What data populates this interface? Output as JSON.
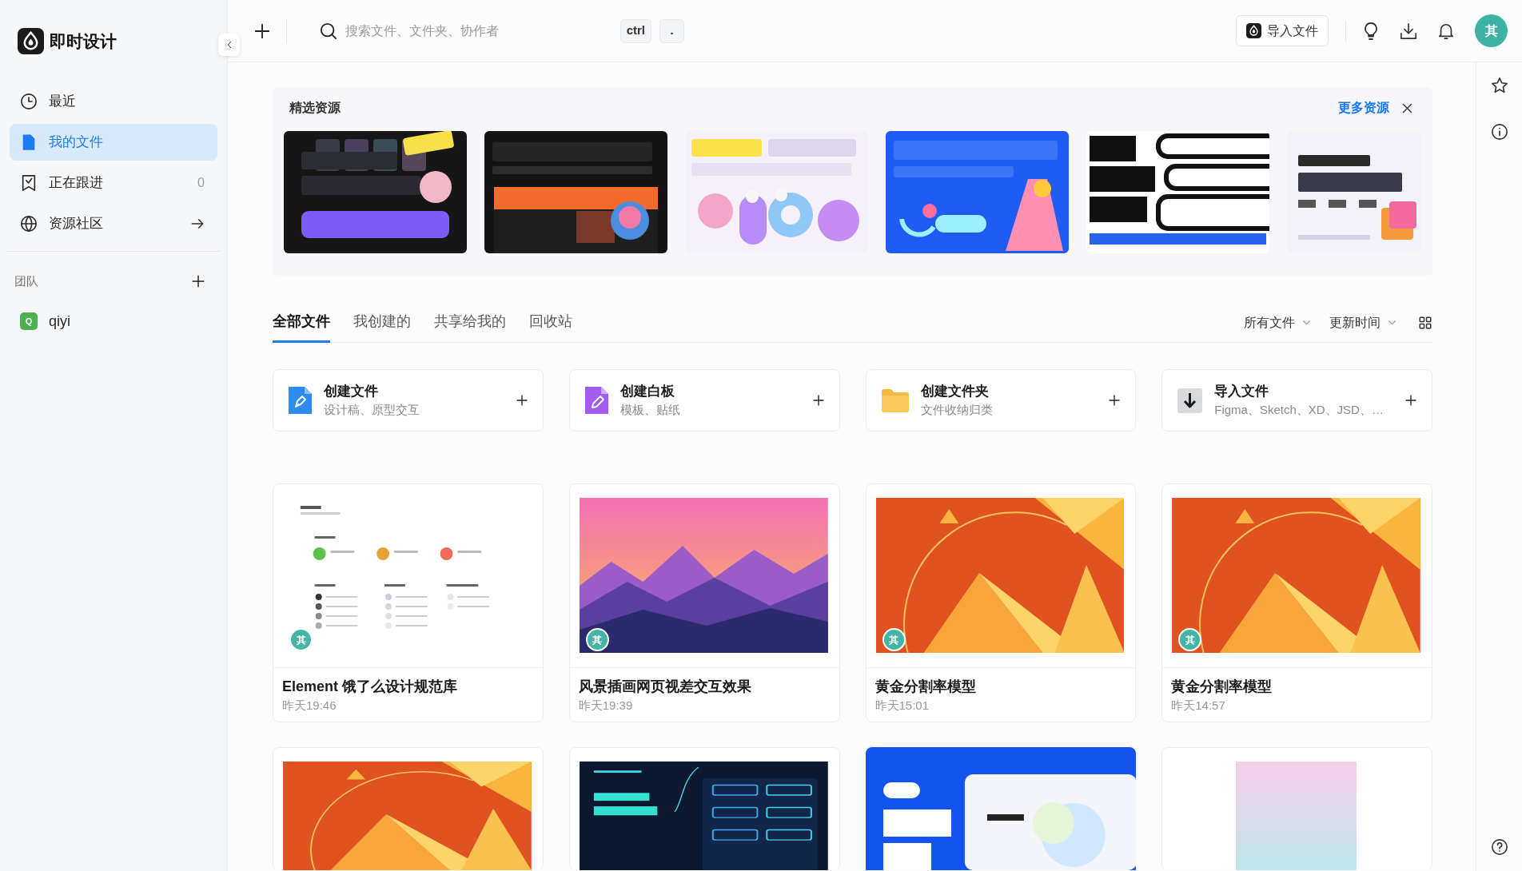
{
  "sidebar": {
    "brand": "即时设计",
    "nav": [
      {
        "label": "最近",
        "selected": false,
        "kind": "page"
      },
      {
        "label": "我的文件",
        "selected": true,
        "kind": "page"
      },
      {
        "label": "正在跟进",
        "selected": false,
        "kind": "page",
        "count": "0"
      },
      {
        "label": "资源社区",
        "selected": false,
        "kind": "link"
      }
    ],
    "team": {
      "title": "团队",
      "items": [
        {
          "name": "qiyi",
          "initial": "Q"
        }
      ]
    }
  },
  "topbar": {
    "search": {
      "placeholder": "搜索文件、文件夹、协作者",
      "shortcut": [
        "ctrl",
        "."
      ]
    },
    "import_button": "导入文件",
    "avatar": "其"
  },
  "resources": {
    "title": "精选资源",
    "more_link": "更多资源",
    "banners": [
      {
        "kind": "ai-promo"
      },
      {
        "kind": "website-promo"
      },
      {
        "kind": "icon-pack"
      },
      {
        "kind": "share-promo"
      },
      {
        "kind": "ios-kit"
      },
      {
        "kind": "portfolio-kit"
      }
    ]
  },
  "tabs": [
    {
      "label": "全部文件",
      "selected": true
    },
    {
      "label": "我创建的",
      "selected": false
    },
    {
      "label": "共享给我的",
      "selected": false
    },
    {
      "label": "回收站",
      "selected": false
    }
  ],
  "filters": [
    "所有文件",
    "更新时间"
  ],
  "create_cards": [
    {
      "title": "创建文件",
      "subtitle": "设计稿、原型交互"
    },
    {
      "title": "创建白板",
      "subtitle": "模板、贴纸"
    },
    {
      "title": "创建文件夹",
      "subtitle": "文件收纳归类"
    },
    {
      "title": "导入文件",
      "subtitle": "Figma、Sketch、XD、JSD、…"
    }
  ],
  "files": [
    {
      "title": "Element 饿了么设计规范库",
      "time": "昨天19:46",
      "owner": "其",
      "kind": "style-guide"
    },
    {
      "title": "风景插画网页视差交互效果",
      "time": "昨天19:39",
      "owner": "其",
      "kind": "landscape"
    },
    {
      "title": "黄金分割率模型",
      "time": "昨天15:01",
      "owner": "其",
      "kind": "golden-ratio"
    },
    {
      "title": "黄金分割率模型",
      "time": "昨天14:57",
      "owner": "其",
      "kind": "golden-ratio"
    },
    {
      "kind": "golden-ratio"
    },
    {
      "kind": "tech-buttons"
    },
    {
      "kind": "portfolio"
    },
    {
      "kind": "gradient"
    }
  ]
}
